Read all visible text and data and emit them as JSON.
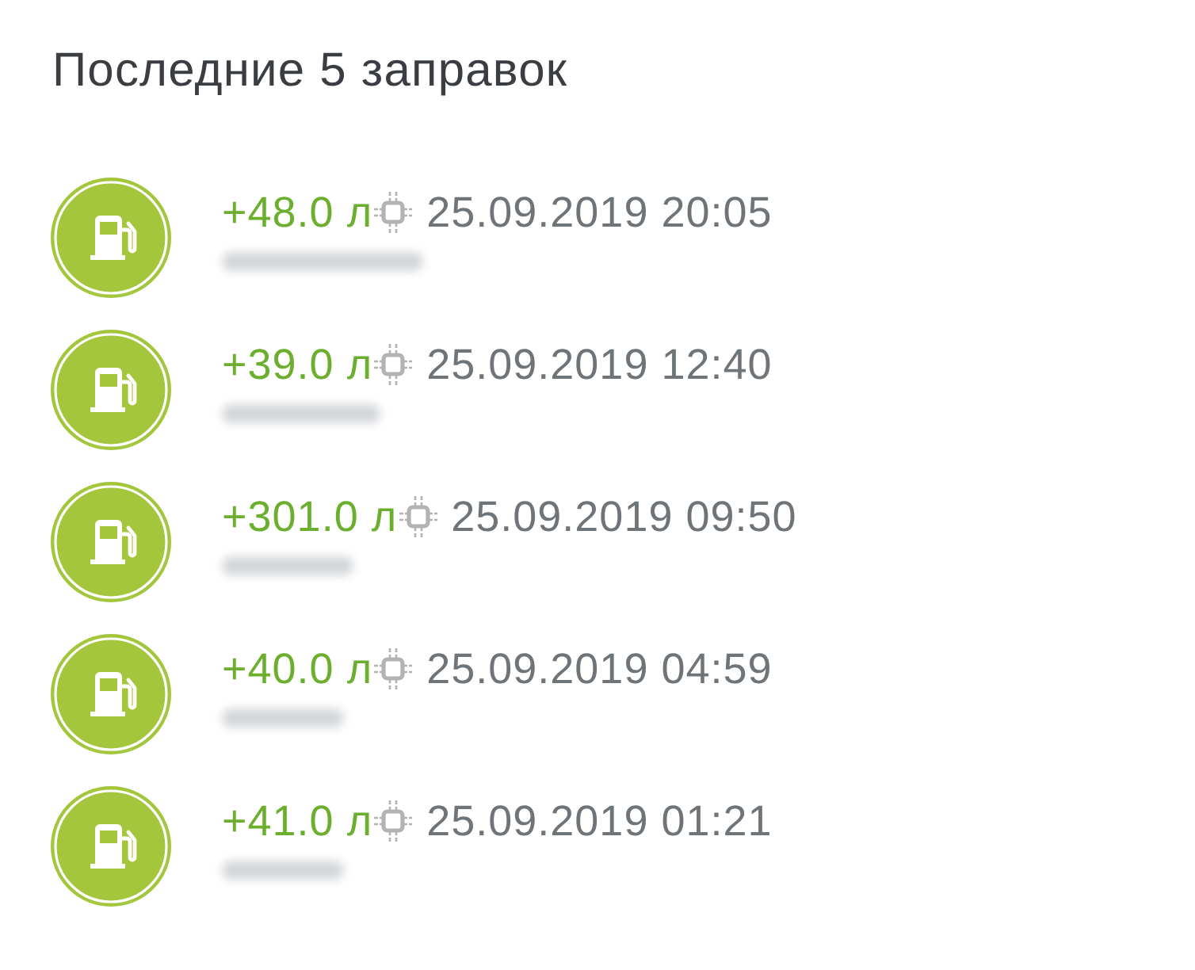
{
  "title": "Последние 5 заправок",
  "refuels": [
    {
      "amount": "+48.0 л",
      "sensor": true,
      "datetime": "25.09.2019 20:05",
      "plate_redacted": true
    },
    {
      "amount": "+39.0 л",
      "sensor": true,
      "datetime": "25.09.2019 12:40",
      "plate_redacted": true
    },
    {
      "amount": "+301.0 л",
      "sensor": true,
      "datetime": "25.09.2019 09:50",
      "plate_redacted": true
    },
    {
      "amount": "+40.0 л",
      "sensor": true,
      "datetime": "25.09.2019 04:59",
      "plate_redacted": true
    },
    {
      "amount": "+41.0 л",
      "sensor": true,
      "datetime": "25.09.2019 01:21",
      "plate_redacted": true
    }
  ]
}
